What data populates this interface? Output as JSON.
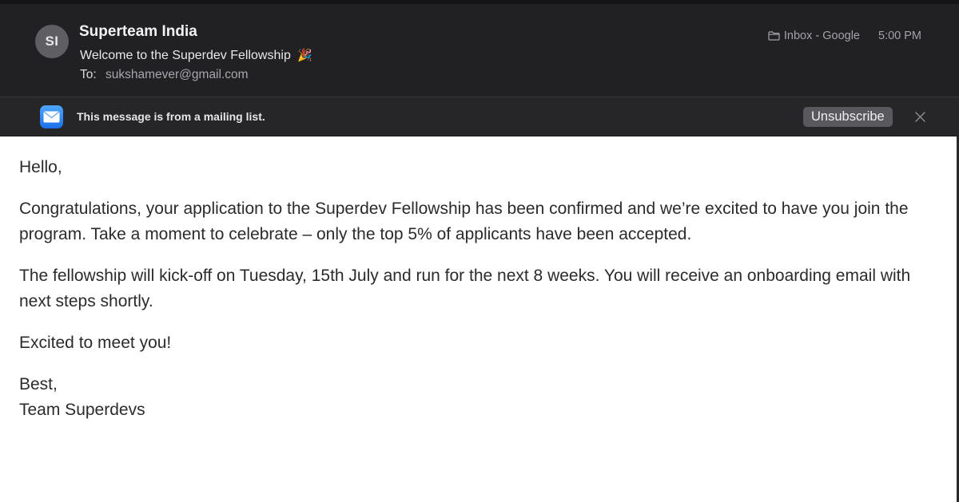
{
  "message": {
    "sender_initials": "SI",
    "sender_name": "Superteam India",
    "subject": "Welcome to the Superdev Fellowship",
    "subject_emoji": "🎉",
    "to_label": "To:",
    "to_address": "sukshamever@gmail.com",
    "folder": "Inbox - Google",
    "time": "5:00 PM"
  },
  "banner": {
    "text": "This message is from a mailing list.",
    "unsubscribe_label": "Unsubscribe",
    "icon": "mail-icon",
    "close_icon": "close-icon"
  },
  "body": {
    "greeting": "Hello,",
    "paragraph_1": "Congratulations, your application to the Superdev Fellowship has been confirmed and we’re excited to have you join the program. Take a moment to celebrate – only the top 5% of applicants have been accepted.",
    "paragraph_2": "The fellowship will kick-off on Tuesday, 15th July and run for the next 8 weeks. You will receive an onboarding email with next steps shortly.",
    "paragraph_3": "Excited to meet you!",
    "signoff": "Best,",
    "signature": "Team Superdevs"
  },
  "colors": {
    "header_bg": "#212124",
    "banner_bg": "#262628",
    "button_bg": "#59595d",
    "body_text": "#2b2b2d"
  }
}
